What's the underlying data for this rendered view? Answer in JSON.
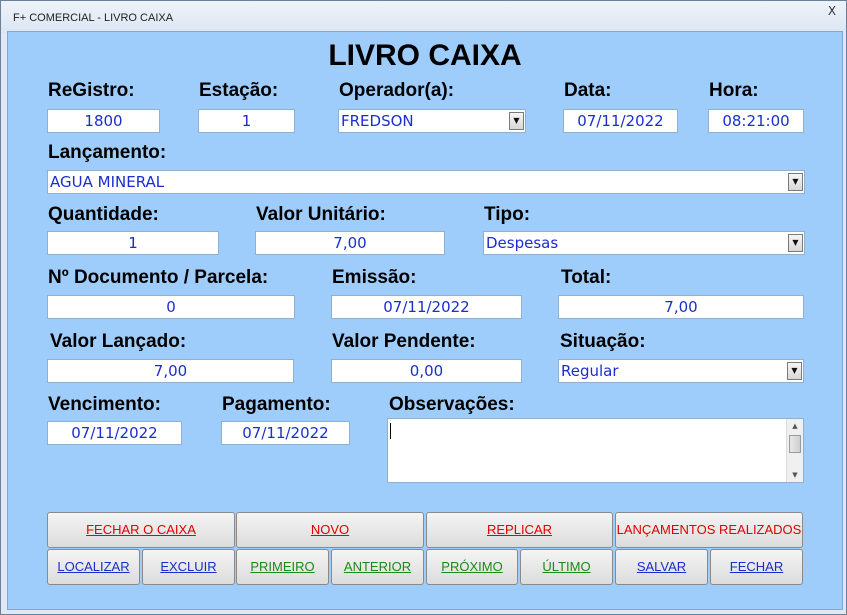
{
  "window": {
    "title": "F+ COMERCIAL - LIVRO CAIXA",
    "close_label": "X"
  },
  "heading": "LIVRO CAIXA",
  "labels": {
    "registro": "ReGistro:",
    "estacao": "Estação:",
    "operador": "Operador(a):",
    "data": "Data:",
    "hora": "Hora:",
    "lancamento": "Lançamento:",
    "quantidade": "Quantidade:",
    "valor_unitario": "Valor Unitário:",
    "tipo": "Tipo:",
    "documento": "Nº Documento / Parcela:",
    "emissao": "Emissão:",
    "total": "Total:",
    "valor_lancado": "Valor Lançado:",
    "valor_pendente": "Valor Pendente:",
    "situacao": "Situação:",
    "vencimento": "Vencimento:",
    "pagamento": "Pagamento:",
    "observacoes": "Observações:"
  },
  "fields": {
    "registro": "1800",
    "estacao": "1",
    "operador": "FREDSON",
    "data": "07/11/2022",
    "hora": "08:21:00",
    "lancamento": "AGUA MINERAL",
    "quantidade": "1",
    "valor_unitario": "7,00",
    "tipo": "Despesas",
    "documento": "0",
    "emissao": "07/11/2022",
    "total": "7,00",
    "valor_lancado": "7,00",
    "valor_pendente": "0,00",
    "situacao": "Regular",
    "vencimento": "07/11/2022",
    "pagamento": "07/11/2022",
    "observacoes": ""
  },
  "buttons": {
    "fechar_caixa": "FECHAR O CAIXA",
    "novo": "NOVO",
    "replicar": "REPLICAR",
    "lancamentos_realizados": "LANÇAMENTOS REALIZADOS",
    "localizar": "LOCALIZAR",
    "excluir": "EXCLUIR",
    "primeiro": "PRIMEIRO",
    "anterior": "ANTERIOR",
    "proximo": "PRÓXIMO",
    "ultimo": "ÚLTIMO",
    "salvar": "SALVAR",
    "fechar": "FECHAR"
  },
  "icons": {
    "dropdown": "chevron-down-icon",
    "scroll_up": "scroll-up-icon",
    "scroll_down": "scroll-down-icon"
  },
  "colors": {
    "background": "#9fcdfb",
    "field_text": "#1a2ecc",
    "red_button_text": "#e00000",
    "blue_button_text": "#1a2ecc",
    "green_button_text": "#1a8a1a"
  }
}
